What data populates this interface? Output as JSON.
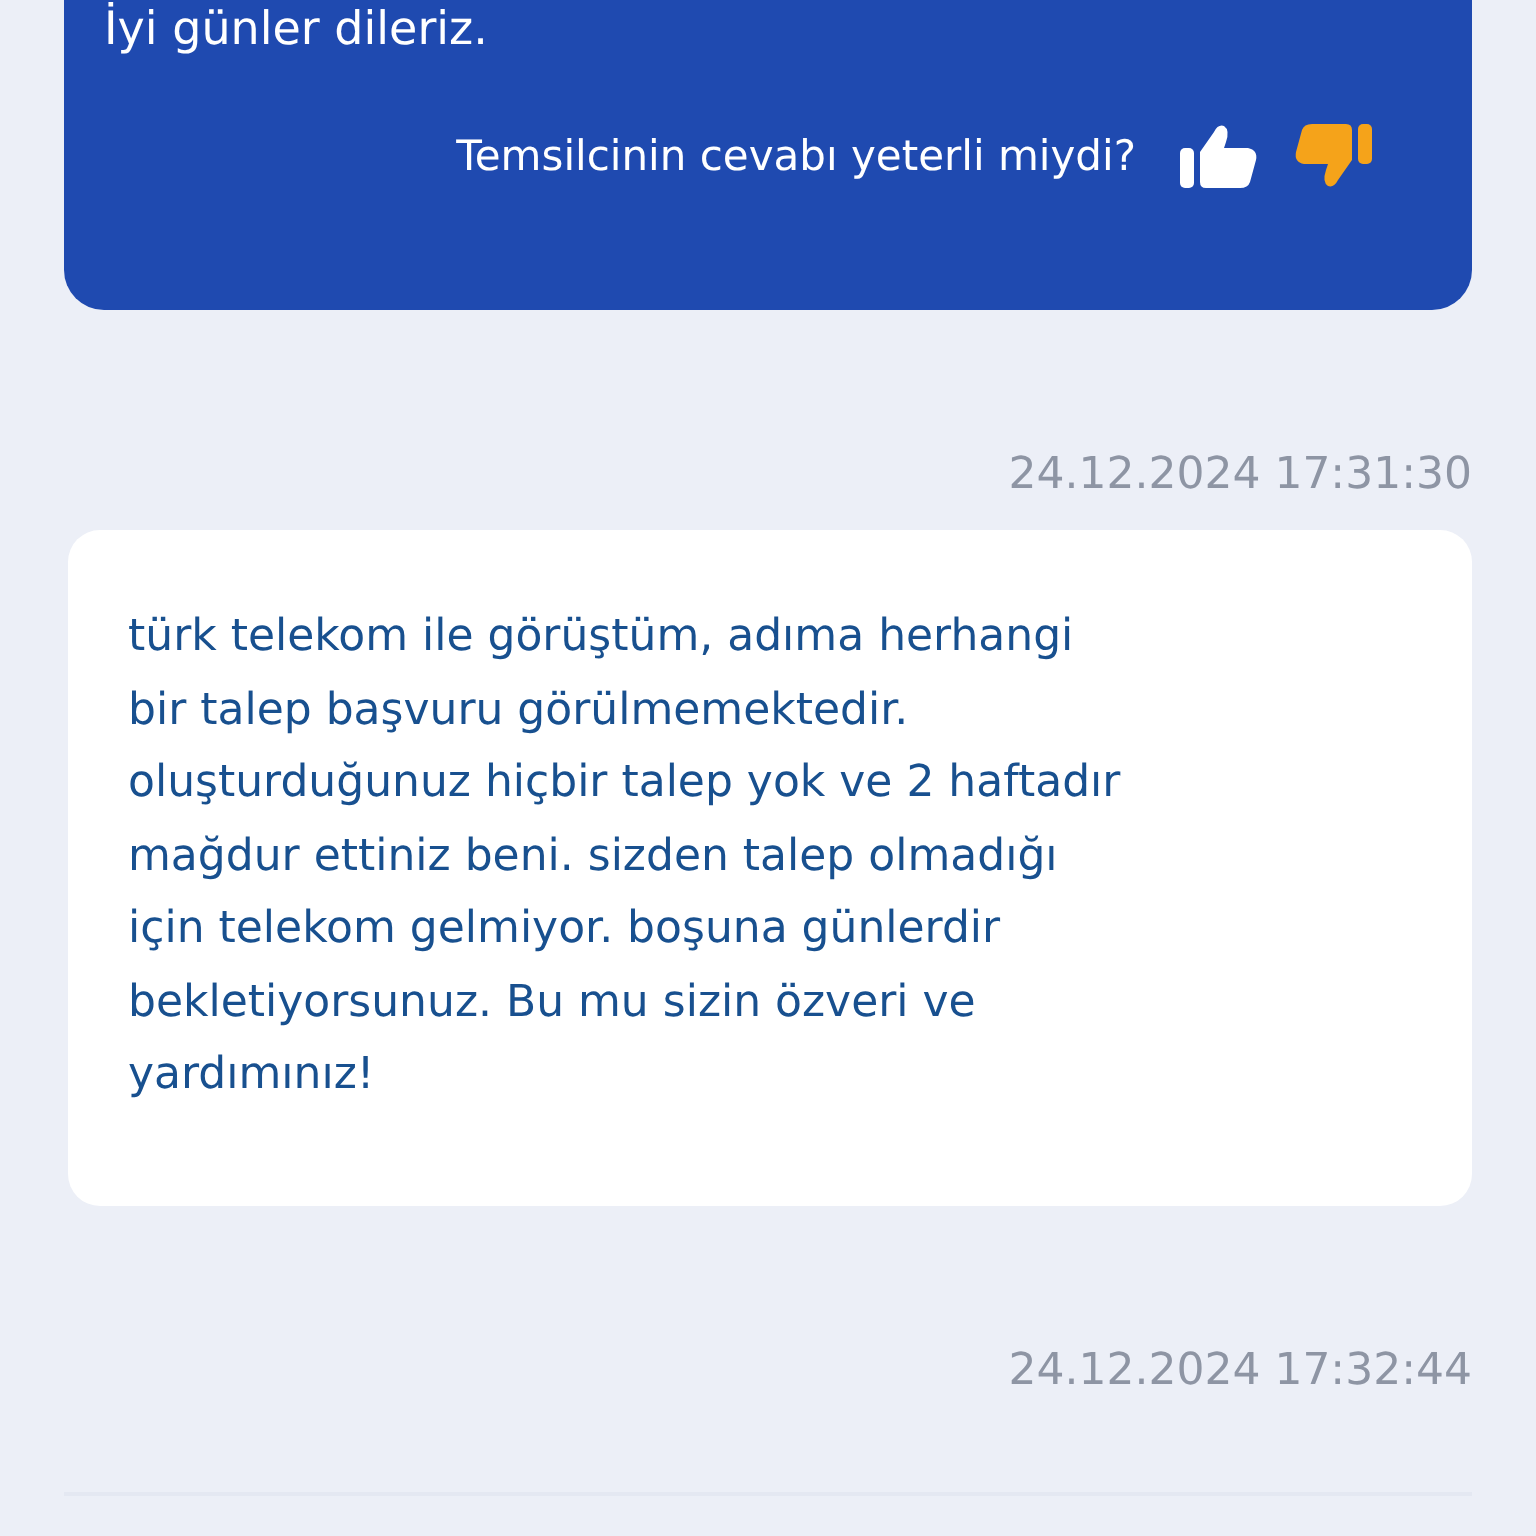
{
  "agent_message": {
    "text": "İyi günler dileriz.",
    "feedback_prompt": "Temsilcinin cevabı yeterli miydi?",
    "feedback": [
      {
        "kind": "up",
        "selected": false
      },
      {
        "kind": "down",
        "selected": true
      }
    ]
  },
  "messages": [
    {
      "timestamp": "24.12.2024 17:31:30",
      "lines": [
        "türk telekom ile görüştüm, adıma herhangi",
        "bir talep başvuru görülmemektedir.",
        "oluşturduğunuz hiçbir talep yok ve 2 haftadır",
        "mağdur ettiniz beni. sizden talep olmadığı",
        "için telekom gelmiyor. boşuna günlerdir",
        "bekletiyorsunuz. Bu mu sizin özveri ve",
        "yardımınız!"
      ]
    },
    {
      "timestamp": "24.12.2024 17:32:44"
    }
  ]
}
